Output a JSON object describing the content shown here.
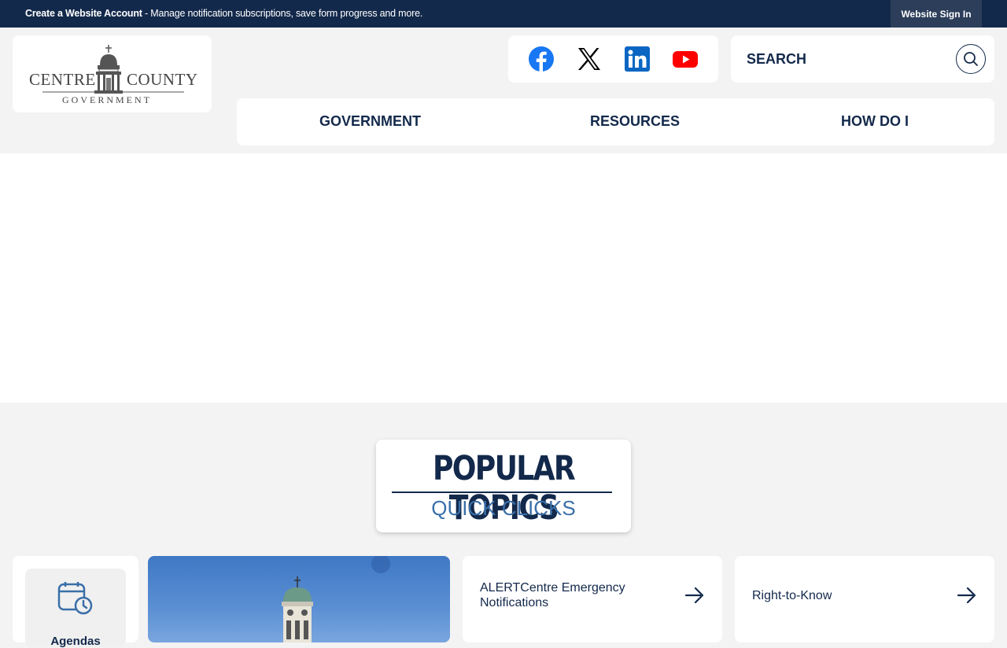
{
  "topbar": {
    "account_link": "Create a Website Account",
    "message": " - Manage notification subscriptions, save form progress and more.",
    "signin": "Website Sign In"
  },
  "logo": {
    "text_left": "CENTRE",
    "text_right": "COUNTY",
    "text_bottom": "GOVERNMENT"
  },
  "social": {
    "icons": [
      "facebook-icon",
      "x-icon",
      "linkedin-icon",
      "youtube-icon"
    ],
    "colors": {
      "facebook": "#1877f2",
      "linkedin": "#0a66c2",
      "youtube": "#ff0000",
      "x": "#000000"
    }
  },
  "search": {
    "placeholder": "SEARCH"
  },
  "nav": {
    "items": [
      {
        "label": "GOVERNMENT"
      },
      {
        "label": "RESOURCES"
      },
      {
        "label": "HOW DO I"
      }
    ]
  },
  "popular": {
    "title": "POPULAR TOPICS",
    "subtitle": "QUICK CLICKS"
  },
  "quick_links": {
    "agendas": "Agendas",
    "alert": "ALERTCentre Emergency Notifications",
    "rtk": "Right-to-Know"
  },
  "colors": {
    "navy": "#13294b",
    "accent_blue": "#3a6fa8",
    "background": "#f3f3f3"
  }
}
